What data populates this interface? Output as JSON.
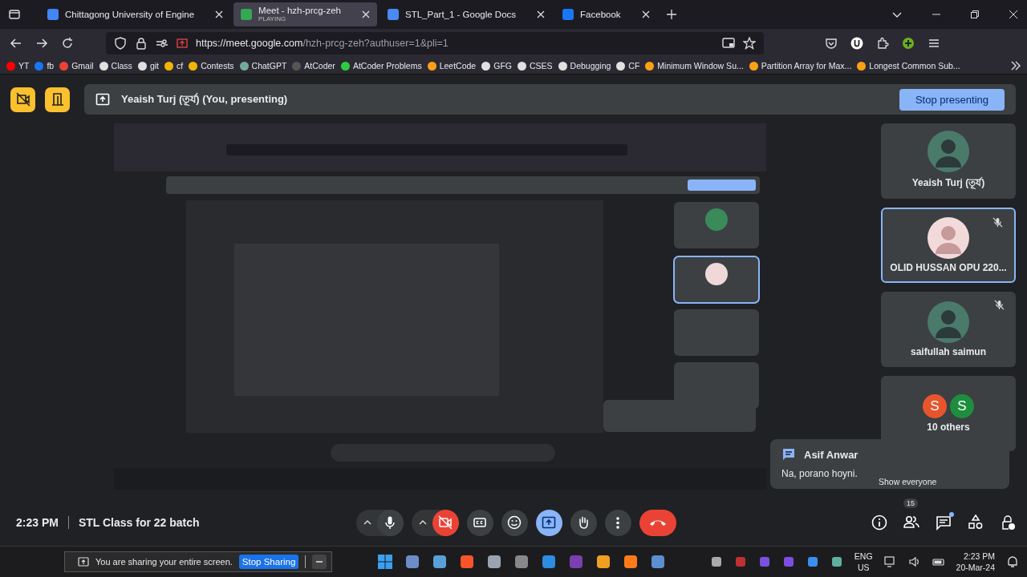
{
  "browser": {
    "tabs": [
      {
        "title": "Chittagong University of Engine",
        "selected": false,
        "color": "#4285f4"
      },
      {
        "title": "Meet - hzh-prcg-zeh",
        "subtitle": "PLAYING",
        "selected": true,
        "color": "#34a853"
      },
      {
        "title": "STL_Part_1 - Google Docs",
        "selected": false,
        "color": "#4a8af4"
      },
      {
        "title": "Facebook",
        "selected": false,
        "color": "#1877f2"
      }
    ],
    "url_host": "https://meet.google.com",
    "url_path": "/hzh-prcg-zeh?authuser=1&pli=1",
    "bookmarks": [
      {
        "label": "YT",
        "color": "#ff0000"
      },
      {
        "label": "fb",
        "color": "#1877f2"
      },
      {
        "label": "Gmail",
        "color": "#ea4335"
      },
      {
        "label": "Class",
        "color": "#e0e0e0"
      },
      {
        "label": "git",
        "color": "#e0e0e0"
      },
      {
        "label": "cf",
        "color": "#f2b705"
      },
      {
        "label": "Contests",
        "color": "#f2b705"
      },
      {
        "label": "ChatGPT",
        "color": "#74aa9c"
      },
      {
        "label": "AtCoder",
        "color": "#555555"
      },
      {
        "label": "AtCoder Problems",
        "color": "#2ecc40"
      },
      {
        "label": "LeetCode",
        "color": "#ffa116"
      },
      {
        "label": "GFG",
        "color": "#e0e0e0"
      },
      {
        "label": "CSES",
        "color": "#e0e0e0"
      },
      {
        "label": "Debugging",
        "color": "#e0e0e0"
      },
      {
        "label": "CF",
        "color": "#e0e0e0"
      },
      {
        "label": "Minimum Window Su...",
        "color": "#ffa116"
      },
      {
        "label": "Partition Array for Max...",
        "color": "#ffa116"
      },
      {
        "label": "Longest Common Sub...",
        "color": "#ffa116"
      }
    ]
  },
  "meet": {
    "presenter": "Yeaish Turj (তূর্য) (You, presenting)",
    "stop_presenting": "Stop presenting",
    "participants": [
      {
        "kind": "person",
        "name": "Yeaish Turj (তূর্য)",
        "muted": false,
        "selected": false
      },
      {
        "kind": "person",
        "name": "OLID HUSSAN OPU 220...",
        "muted": true,
        "selected": true
      },
      {
        "kind": "person",
        "name": "saifullah saimun",
        "muted": true,
        "selected": false
      },
      {
        "kind": "others",
        "name": "10 others",
        "muted": false,
        "selected": false,
        "initials": [
          {
            "letter": "S",
            "color": "#e8552d"
          },
          {
            "letter": "S",
            "color": "#1e8e3e"
          }
        ]
      }
    ],
    "chat_toast": {
      "sender": "Asif Anwar",
      "message": "Na, porano hoyni."
    },
    "tooltip": "Show everyone",
    "people_count": "15",
    "chat_unread": true,
    "time": "2:23 PM",
    "title": "STL Class for 22 batch",
    "camera_on": false,
    "presenting": true
  },
  "taskbar": {
    "sharing_notice": "You are sharing your entire screen.",
    "stop_sharing": "Stop Sharing",
    "lang": "ENG",
    "region": "US",
    "time": "2:23 PM",
    "date": "20-Mar-24"
  }
}
